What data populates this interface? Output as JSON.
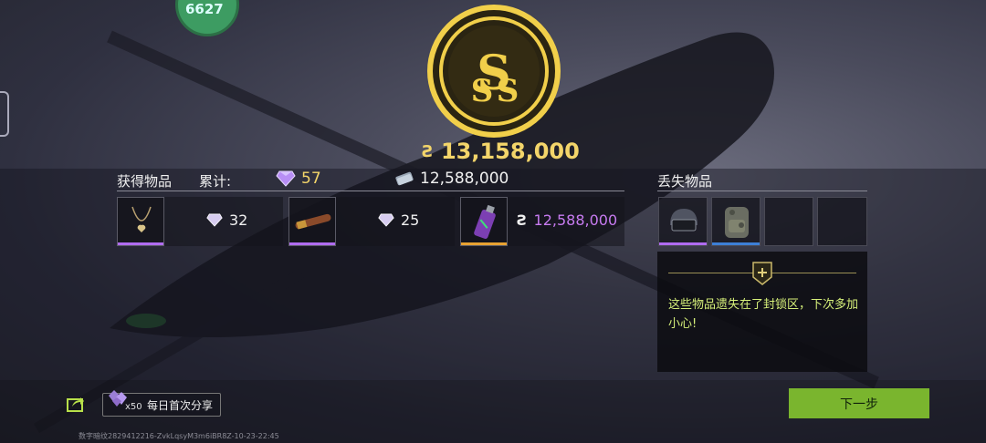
{
  "hud": {
    "badge_text": "6627"
  },
  "reward": {
    "total_currency_symbol": "Ƨ",
    "total_amount": "13,158,000"
  },
  "gained": {
    "title": "获得物品",
    "sum_label": "累计:",
    "sum_gems": "57",
    "sum_cash": "12,588,000",
    "items": [
      {
        "icon": "necklace-icon",
        "value": "32",
        "value_icon": "diamond-icon",
        "rarity_color": "#b06cf0"
      },
      {
        "icon": "cigar-icon",
        "value": "25",
        "value_icon": "diamond-icon",
        "rarity_color": "#b06cf0"
      },
      {
        "icon": "spray-can-icon",
        "value_symbol": "Ƨ",
        "value": "12,588,000",
        "rarity_color": "#e8a232"
      }
    ]
  },
  "lost": {
    "title": "丢失物品",
    "items": [
      {
        "icon": "helmet-icon",
        "rarity_color": "#b06cf0"
      },
      {
        "icon": "backpack-icon",
        "rarity_color": "#3d7fd6"
      },
      {
        "icon": "empty-slot"
      },
      {
        "icon": "empty-slot"
      }
    ],
    "message": "这些物品遗失在了封锁区，下次多加小心!"
  },
  "share": {
    "count": "x50",
    "label": "每日首次分享"
  },
  "footer": {
    "watermark": "数字暗纹2829412216-ZvkLqsyM3m6iBR8Z-10-23-22:45"
  },
  "buttons": {
    "next": "下一步"
  },
  "colors": {
    "gold": "#f3d56a",
    "purple_value": "#c77bf0",
    "accent_green": "#7ab52e",
    "lost_message": "#d6f07a"
  }
}
